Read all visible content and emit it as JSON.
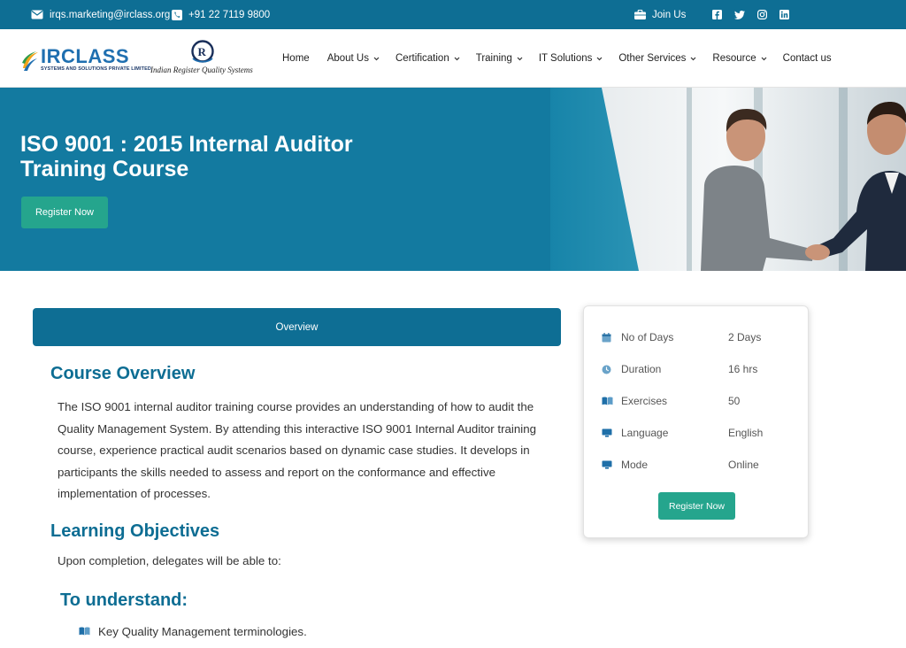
{
  "topbar": {
    "email": "irqs.marketing@irclass.org",
    "phone": "+91 22 7119 9800",
    "join": "Join Us",
    "social": [
      "facebook-icon",
      "twitter-icon",
      "instagram-icon",
      "linkedin-icon"
    ]
  },
  "brand": {
    "name": "IRCLASS",
    "tagline": "SYSTEMS AND SOLUTIONS PRIVATE LIMITED",
    "partner_name": "Indian Register Quality Systems"
  },
  "nav": {
    "items": [
      {
        "label": "Home",
        "dropdown": false
      },
      {
        "label": "About Us",
        "dropdown": true
      },
      {
        "label": "Certification",
        "dropdown": true
      },
      {
        "label": "Training",
        "dropdown": true
      },
      {
        "label": "IT Solutions",
        "dropdown": true
      },
      {
        "label": "Other Services",
        "dropdown": true
      },
      {
        "label": "Resource",
        "dropdown": true
      },
      {
        "label": "Contact us",
        "dropdown": false
      }
    ]
  },
  "hero": {
    "title_line1": "ISO 9001 : 2015 Internal Auditor",
    "title_line2": "Training Course",
    "button": "Register Now"
  },
  "content": {
    "tab": "Overview",
    "course_overview_heading": "Course Overview",
    "course_overview_text": "The ISO 9001 internal auditor training course provides an understanding of how to audit the Quality Management System. By attending this interactive ISO 9001 Internal Auditor training course, experience practical audit scenarios based on dynamic case studies. It develops in participants the skills needed to assess and report on the conformance and effective implementation of processes.",
    "learning_heading": "Learning Objectives",
    "learning_lead": "Upon completion, delegates will be able to:",
    "understand_heading": "To understand:",
    "bullets": [
      "Key Quality Management terminologies."
    ]
  },
  "details": {
    "rows": [
      {
        "icon": "calendar-icon",
        "label": "No of Days",
        "value": "2 Days"
      },
      {
        "icon": "clock-icon",
        "label": "Duration",
        "value": "16 hrs"
      },
      {
        "icon": "book-icon",
        "label": "Exercises",
        "value": "50"
      },
      {
        "icon": "monitor-icon",
        "label": "Language",
        "value": "English"
      },
      {
        "icon": "monitor-icon",
        "label": "Mode",
        "value": "Online"
      }
    ],
    "button": "Register Now"
  },
  "colors": {
    "primary": "#0e6e94",
    "hero": "#137aa0",
    "accent_green": "#25a58d",
    "heading": "#0d6d93"
  }
}
